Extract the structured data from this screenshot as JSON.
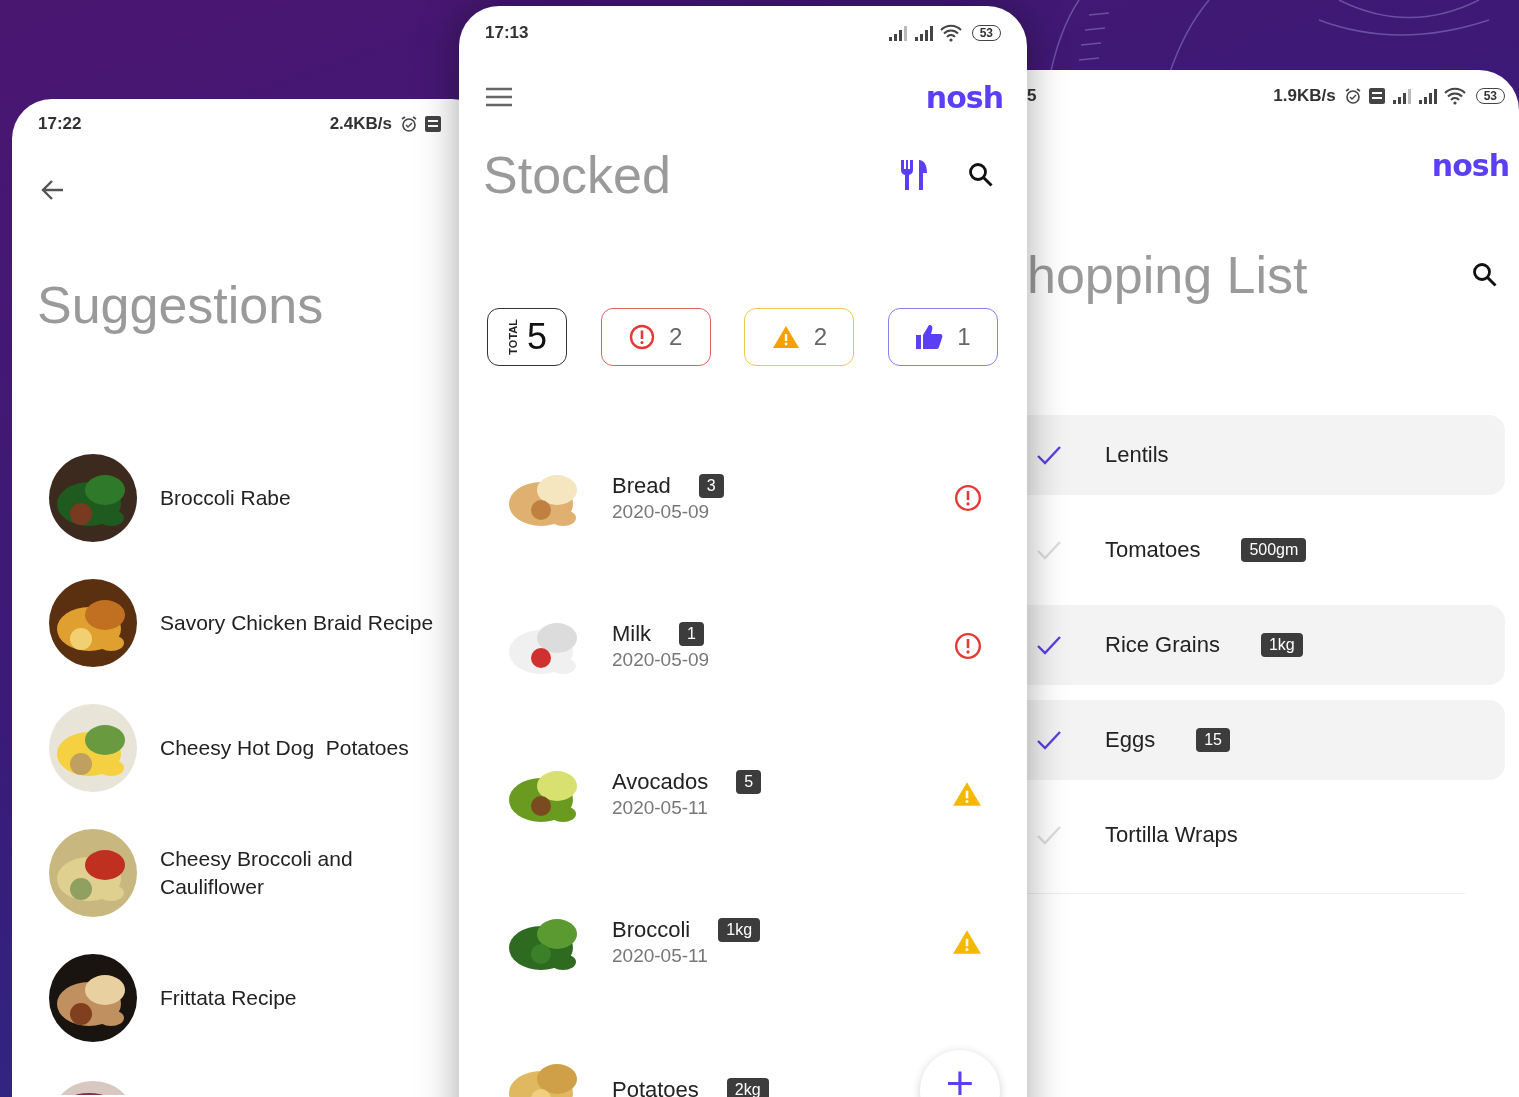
{
  "suggestions": {
    "status_bar": {
      "time": "17:22",
      "speed": "2.4KB/s"
    },
    "title": "Suggestions",
    "recipes": [
      {
        "name": "Broccoli Rabe"
      },
      {
        "name": "Savory Chicken Braid Recipe"
      },
      {
        "name": "Cheesy Hot Dog  Potatoes"
      },
      {
        "name": "Cheesy Broccoli and Cauliflower"
      },
      {
        "name": "Frittata Recipe"
      }
    ]
  },
  "stocked": {
    "status_bar": {
      "time": "17:13",
      "battery": "53"
    },
    "logo": "nosh",
    "title": "Stocked",
    "summary": [
      {
        "kind": "total",
        "label": "TOTAL",
        "count": "5"
      },
      {
        "kind": "expired",
        "count": "2"
      },
      {
        "kind": "expiring",
        "count": "2"
      },
      {
        "kind": "fresh",
        "count": "1"
      }
    ],
    "items": [
      {
        "name": "Bread",
        "quantity": "3",
        "date": "2020-05-09",
        "kind": "expired"
      },
      {
        "name": "Milk",
        "quantity": "1",
        "date": "2020-05-09",
        "kind": "expired"
      },
      {
        "name": "Avocados",
        "quantity": "5",
        "date": "2020-05-11",
        "kind": "expiring"
      },
      {
        "name": "Broccoli",
        "quantity": "1kg",
        "date": "2020-05-11",
        "kind": "expiring"
      },
      {
        "name": "Potatoes",
        "quantity": "2kg"
      }
    ],
    "add_button": "+"
  },
  "shopping": {
    "status_bar": {
      "time": "5",
      "speed": "1.9KB/s",
      "battery": "53"
    },
    "logo": "nosh",
    "title": "hopping List",
    "items": [
      {
        "name": "Lentils",
        "checked": true
      },
      {
        "name": "Tomatoes",
        "quantity": "500gm",
        "checked": false
      },
      {
        "name": "Rice Grains",
        "quantity": "1kg",
        "checked": true
      },
      {
        "name": "Eggs",
        "quantity": "15",
        "checked": true
      },
      {
        "name": "Tortilla Wraps",
        "checked": false
      }
    ]
  }
}
